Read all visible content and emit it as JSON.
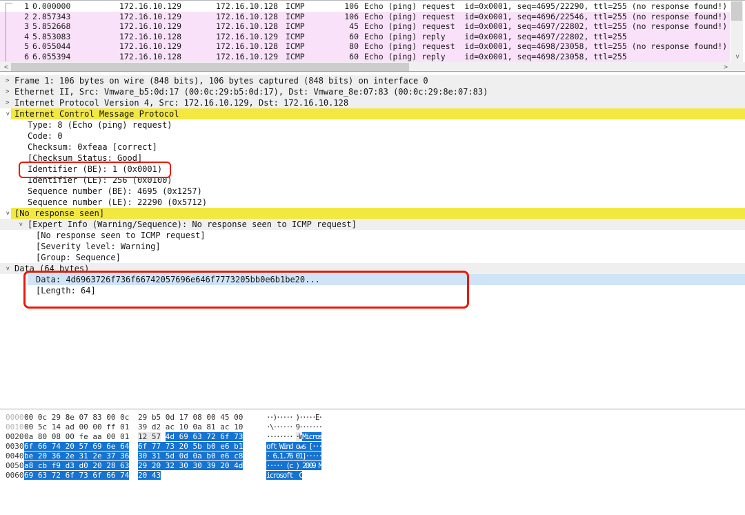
{
  "colors": {
    "icmp_row_pink": "#f9e2f9",
    "selected_row_white": "#ffffff",
    "highlight_yellow": "#f2e840",
    "highlight_blue": "#cfe4f7",
    "row_gray": "#efefef",
    "hex_selection_blue": "#1573d2",
    "hex_related_gray": "#e9e9e9",
    "annotation_red": "#ee1607",
    "scrollbar_track": "#f0f0f0",
    "scrollbar_thumb": "#cdcdcd"
  },
  "scrollbars": {
    "left_glyph": "<",
    "right_glyph": ">",
    "down_glyph": ">"
  },
  "packet_list": {
    "rows": [
      {
        "no": "1",
        "time": "0.000000",
        "source": "172.16.10.129",
        "destination": "172.16.10.128",
        "protocol": "ICMP",
        "length": "106",
        "info": "Echo (ping) request  id=0x0001, seq=4695/22290, ttl=255 (no response found!)",
        "bg": "white"
      },
      {
        "no": "2",
        "time": "2.857343",
        "source": "172.16.10.129",
        "destination": "172.16.10.128",
        "protocol": "ICMP",
        "length": "106",
        "info": "Echo (ping) request  id=0x0001, seq=4696/22546, ttl=255 (no response found!)",
        "bg": "pink"
      },
      {
        "no": "3",
        "time": "5.852668",
        "source": "172.16.10.129",
        "destination": "172.16.10.128",
        "protocol": "ICMP",
        "length": "45",
        "info": "Echo (ping) request  id=0x0001, seq=4697/22802, ttl=255 (no response found!)",
        "bg": "pink"
      },
      {
        "no": "4",
        "time": "5.853083",
        "source": "172.16.10.128",
        "destination": "172.16.10.129",
        "protocol": "ICMP",
        "length": "60",
        "info": "Echo (ping) reply    id=0x0001, seq=4697/22802, ttl=255",
        "bg": "pink"
      },
      {
        "no": "5",
        "time": "6.055044",
        "source": "172.16.10.129",
        "destination": "172.16.10.128",
        "protocol": "ICMP",
        "length": "80",
        "info": "Echo (ping) request  id=0x0001, seq=4698/23058, ttl=255 (no response found!)",
        "bg": "pink"
      },
      {
        "no": "6",
        "time": "6.055394",
        "source": "172.16.10.128",
        "destination": "172.16.10.129",
        "protocol": "ICMP",
        "length": "60",
        "info": "Echo (ping) reply    id=0x0001, seq=4698/23058, ttl=255",
        "bg": "pink"
      }
    ]
  },
  "details": {
    "rows": [
      {
        "text": "Frame 1: 106 bytes on wire (848 bits), 106 bytes captured (848 bits) on interface 0",
        "chevron": "collapsed",
        "indent": 0,
        "bg": "gray"
      },
      {
        "text": "Ethernet II, Src: Vmware_b5:0d:17 (00:0c:29:b5:0d:17), Dst: Vmware_8e:07:83 (00:0c:29:8e:07:83)",
        "chevron": "collapsed",
        "indent": 0,
        "bg": "gray"
      },
      {
        "text": "Internet Protocol Version 4, Src: 172.16.10.129, Dst: 172.16.10.128",
        "chevron": "collapsed",
        "indent": 0,
        "bg": "gray"
      },
      {
        "text": "Internet Control Message Protocol",
        "chevron": "expanded",
        "indent": 0,
        "bg": "yellow"
      },
      {
        "text": "Type: 8 (Echo (ping) request)",
        "chevron": "none",
        "indent": 1,
        "bg": "none"
      },
      {
        "text": "Code: 0",
        "chevron": "none",
        "indent": 1,
        "bg": "none"
      },
      {
        "text": "Checksum: 0xfeaa [correct]",
        "chevron": "none",
        "indent": 1,
        "bg": "none"
      },
      {
        "text": "[Checksum Status: Good]",
        "chevron": "none",
        "indent": 1,
        "bg": "none"
      },
      {
        "text": "Identifier (BE): 1 (0x0001)",
        "chevron": "none",
        "indent": 1,
        "bg": "none"
      },
      {
        "text": "Identifier (LE): 256 (0x0100)",
        "chevron": "none",
        "indent": 1,
        "bg": "none"
      },
      {
        "text": "Sequence number (BE): 4695 (0x1257)",
        "chevron": "none",
        "indent": 1,
        "bg": "none"
      },
      {
        "text": "Sequence number (LE): 22290 (0x5712)",
        "chevron": "none",
        "indent": 1,
        "bg": "none"
      },
      {
        "text": "[No response seen]",
        "chevron": "expanded",
        "indent": 0,
        "bg": "yellow"
      },
      {
        "text": "[Expert Info (Warning/Sequence): No response seen to ICMP request]",
        "chevron": "expanded",
        "indent": 1,
        "bg": "gray"
      },
      {
        "text": "[No response seen to ICMP request]",
        "chevron": "none",
        "indent": 2,
        "bg": "none"
      },
      {
        "text": "[Severity level: Warning]",
        "chevron": "none",
        "indent": 2,
        "bg": "none"
      },
      {
        "text": "[Group: Sequence]",
        "chevron": "none",
        "indent": 2,
        "bg": "none"
      },
      {
        "text": "Data (64 bytes)",
        "chevron": "expanded",
        "indent": 0,
        "bg": "gray"
      },
      {
        "text": "Data: 4d6963726f736f66742057696e646f7773205bb0e6b1be20...",
        "chevron": "none",
        "indent": 2,
        "bg": "blue"
      },
      {
        "text": "[Length: 64]",
        "chevron": "none",
        "indent": 2,
        "bg": "none"
      }
    ]
  },
  "hex": {
    "rows": [
      {
        "offset": "0000",
        "dim": true,
        "g1": [
          [
            "00 0c 29 8e 07 83 00 0c",
            "n"
          ]
        ],
        "g2": [
          [
            "29 b5 0d 17 08 00 45 00",
            "n"
          ]
        ],
        "ascii": [
          [
            "··)····· )·····E·",
            "n"
          ]
        ]
      },
      {
        "offset": "0010",
        "dim": true,
        "g1": [
          [
            "00 5c 14 ad 00 00 ff 01",
            "n"
          ]
        ],
        "g2": [
          [
            "39 d2 ac 10 0a 81 ac 10",
            "n"
          ]
        ],
        "ascii": [
          [
            "·\\······ 9·······",
            "n"
          ]
        ]
      },
      {
        "offset": "0020",
        "dim": false,
        "g1": [
          [
            "0a 80 08 00 fe aa 00 01",
            "n"
          ]
        ],
        "g2": [
          [
            "12 57",
            "g"
          ],
          [
            " ",
            "n"
          ],
          [
            "4d 69 63 72 6f 73",
            "s"
          ]
        ],
        "ascii": [
          [
            "········ ",
            "n"
          ],
          [
            "·W",
            "g"
          ],
          [
            "Micros",
            "s"
          ]
        ]
      },
      {
        "offset": "0030",
        "dim": false,
        "g1": [
          [
            "6f 66 74 20 57 69 6e 64",
            "s"
          ]
        ],
        "g2": [
          [
            "6f 77 73 20 5b b0 e6 b1",
            "s"
          ]
        ],
        "ascii": [
          [
            "oft Wind ows [···",
            "s"
          ]
        ]
      },
      {
        "offset": "0040",
        "dim": false,
        "g1": [
          [
            "be 20 36 2e 31 2e 37 36",
            "s"
          ]
        ],
        "g2": [
          [
            "30 31 5d 0d 0a b0 e6 c8",
            "s"
          ]
        ],
        "ascii": [
          [
            "· 6.1.76 01]·····",
            "s"
          ]
        ]
      },
      {
        "offset": "0050",
        "dim": false,
        "g1": [
          [
            "a8 cb f9 d3 d0 20 28 63",
            "s"
          ]
        ],
        "g2": [
          [
            "29 20 32 30 30 39 20 4d",
            "s"
          ]
        ],
        "ascii": [
          [
            "····· (c ) 2009 M",
            "s"
          ]
        ]
      },
      {
        "offset": "0060",
        "dim": false,
        "g1": [
          [
            "69 63 72 6f 73 6f 66 74",
            "s"
          ]
        ],
        "g2": [
          [
            "20 43",
            "s"
          ]
        ],
        "ascii": [
          [
            "icrosoft  C",
            "s"
          ]
        ]
      }
    ]
  }
}
